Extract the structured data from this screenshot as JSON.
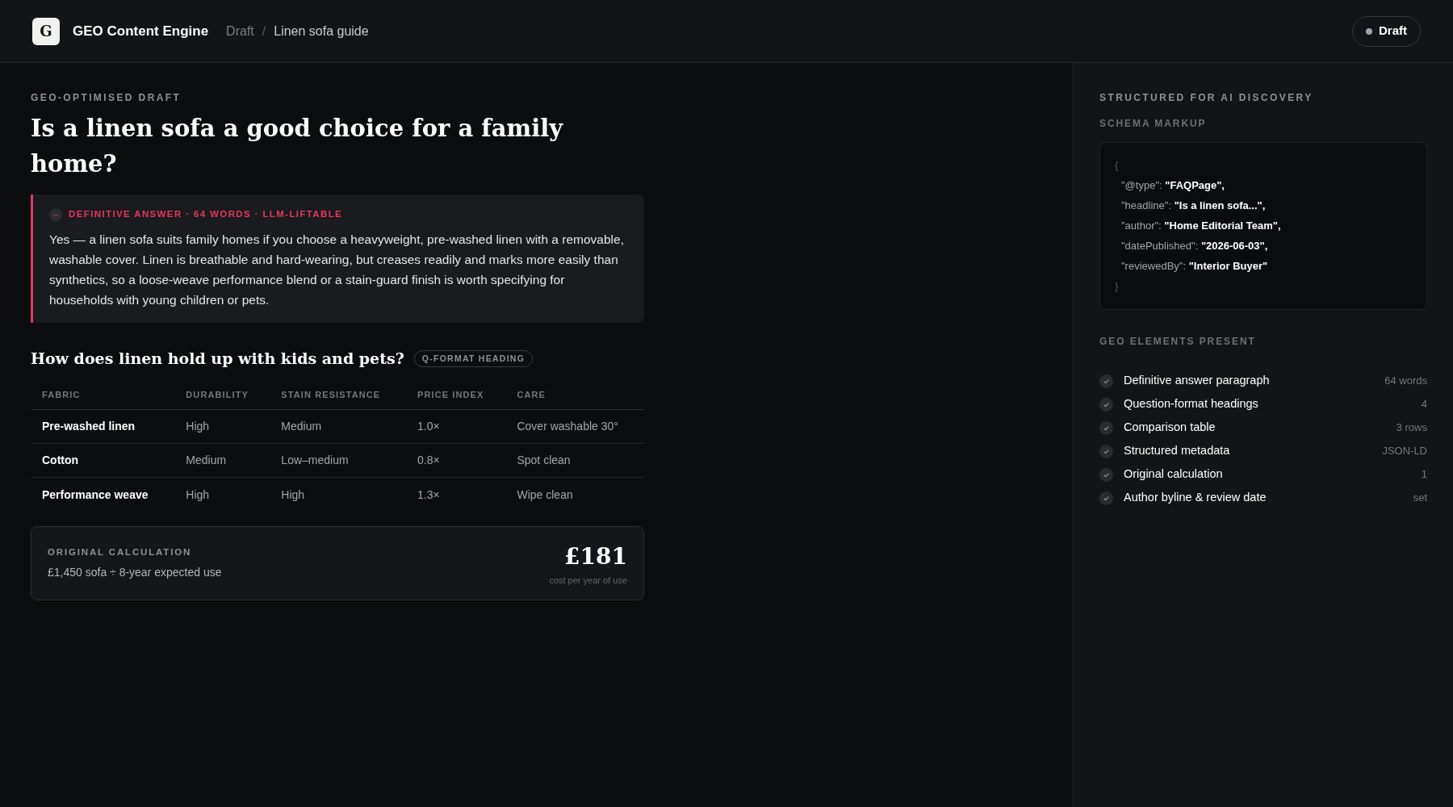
{
  "header": {
    "logo": "G",
    "app_name": "GEO Content Engine",
    "breadcrumb": [
      "Draft",
      "Linen sofa guide"
    ],
    "separator": "/",
    "status": {
      "label": "Draft",
      "color": "#9ca3af"
    }
  },
  "article": {
    "eyebrow": "GEO-OPTIMISED DRAFT",
    "title": "Is a linen sofa a good choice for a family home?",
    "answer": {
      "icon": "–",
      "label": "DEFINITIVE ANSWER · 64 WORDS · LLM-LIFTABLE",
      "text": "Yes — a linen sofa suits family homes if you choose a heavyweight, pre-washed linen with a removable, washable cover. Linen is breathable and hard-wearing, but creases readily and marks more easily than synthetics, so a loose-weave performance blend or a stain-guard finish is worth specifying for households with young children or pets."
    },
    "section_heading": "How does linen hold up with kids and pets?",
    "section_badge": "Q-FORMAT HEADING",
    "table": {
      "columns": [
        "FABRIC",
        "DURABILITY",
        "STAIN RESISTANCE",
        "PRICE INDEX",
        "CARE"
      ],
      "rows": [
        [
          "Pre-washed linen",
          "High",
          "Medium",
          "1.0×",
          "Cover washable 30°"
        ],
        [
          "Cotton",
          "Medium",
          "Low–medium",
          "0.8×",
          "Spot clean"
        ],
        [
          "Performance weave",
          "High",
          "High",
          "1.3×",
          "Wipe clean"
        ]
      ]
    },
    "calculation": {
      "label": "ORIGINAL CALCULATION",
      "formula": "£1,450 sofa ÷ 8-year expected use",
      "value": "£181",
      "caption": "cost per year of use"
    }
  },
  "sidebar": {
    "title": "STRUCTURED FOR AI DISCOVERY",
    "schema_title": "SCHEMA MARKUP",
    "schema": {
      "open": "{",
      "close": "}",
      "lines": [
        {
          "key": "\"@type\":",
          "value": "\"FAQPage\","
        },
        {
          "key": "\"headline\":",
          "value": "\"Is a linen sofa...\","
        },
        {
          "key": "\"author\":",
          "value": "\"Home Editorial Team\","
        },
        {
          "key": "\"datePublished\":",
          "value": "\"2026-06-03\","
        },
        {
          "key": "\"reviewedBy\":",
          "value": "\"Interior Buyer\""
        }
      ]
    },
    "elements_title": "GEO ELEMENTS PRESENT",
    "elements": [
      {
        "label": "Definitive answer paragraph",
        "value": "64 words",
        "checked": true
      },
      {
        "label": "Question-format headings",
        "value": "4",
        "checked": true
      },
      {
        "label": "Comparison table",
        "value": "3 rows",
        "checked": true
      },
      {
        "label": "Structured metadata",
        "value": "JSON-LD",
        "checked": true
      },
      {
        "label": "Original calculation",
        "value": "1",
        "checked": true
      },
      {
        "label": "Author byline & review date",
        "value": "set",
        "checked": true
      }
    ]
  }
}
